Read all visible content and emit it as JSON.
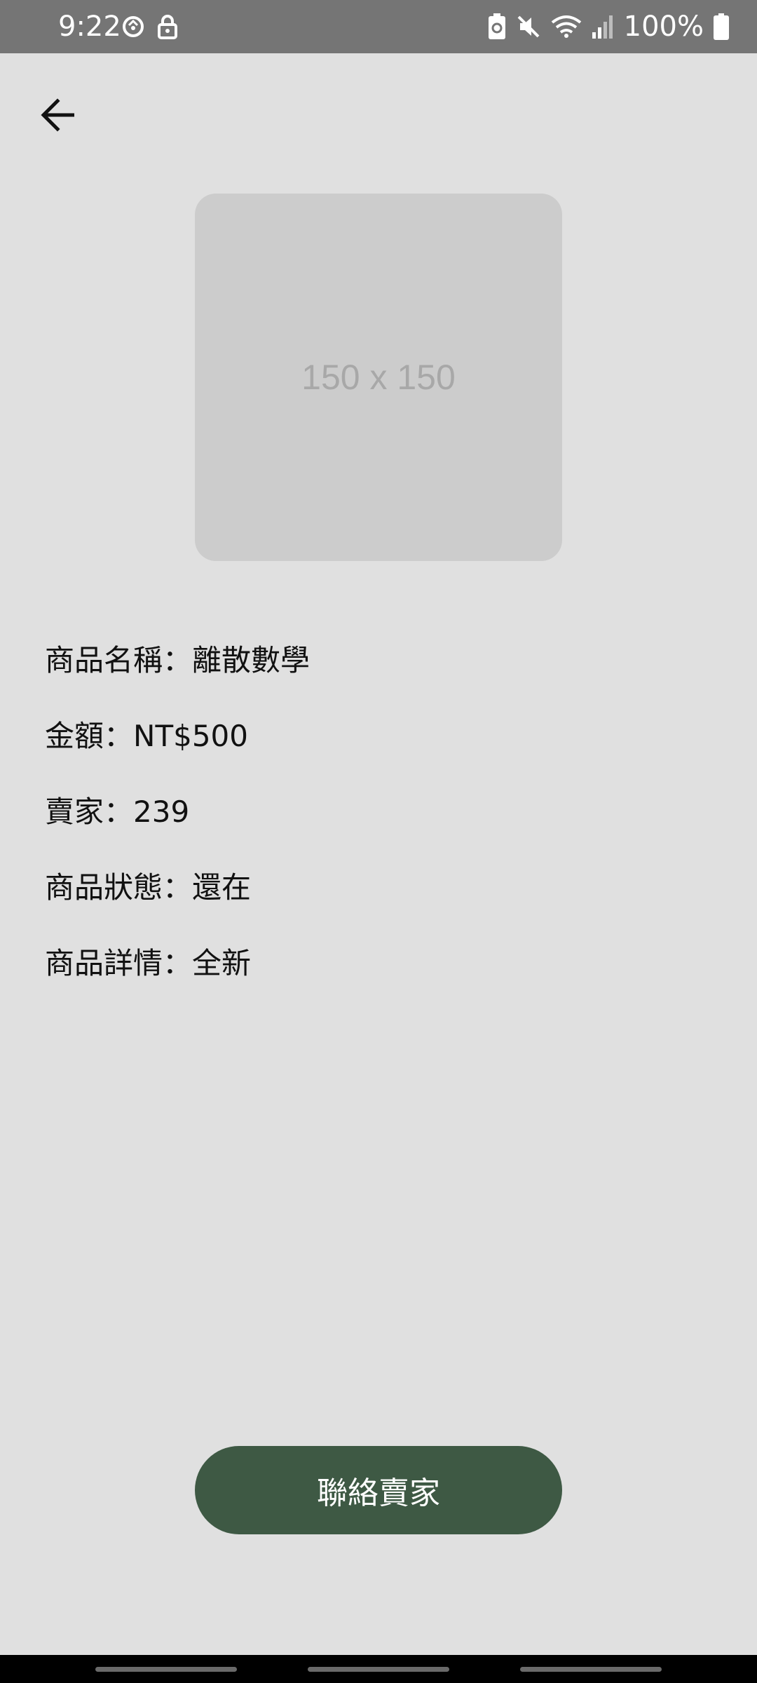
{
  "status_bar": {
    "time": "9:22",
    "battery": "100%",
    "icons": [
      "sync-icon",
      "lock-icon",
      "battery-saver-icon",
      "mute-icon",
      "wifi-icon",
      "signal-icon",
      "battery-icon"
    ]
  },
  "header": {
    "back_icon": "arrow-left-icon"
  },
  "product": {
    "image_placeholder": "150 x 150",
    "fields": [
      {
        "label": "商品名稱",
        "sep": "：",
        "value": "離散數學"
      },
      {
        "label": "金額",
        "sep": "：",
        "value": "NT$500"
      },
      {
        "label": "賣家",
        "sep": "：",
        "value": "239"
      },
      {
        "label": "商品狀態",
        "sep": "：",
        "value": "還在"
      },
      {
        "label": "商品詳情",
        "sep": "：",
        "value": "全新"
      }
    ]
  },
  "actions": {
    "contact_seller": "聯絡賣家"
  },
  "colors": {
    "status_bar_bg": "#757575",
    "page_bg": "#e0e0e0",
    "placeholder_bg": "#cccccc",
    "button_bg": "#3e5944",
    "button_text": "#ffffff"
  }
}
